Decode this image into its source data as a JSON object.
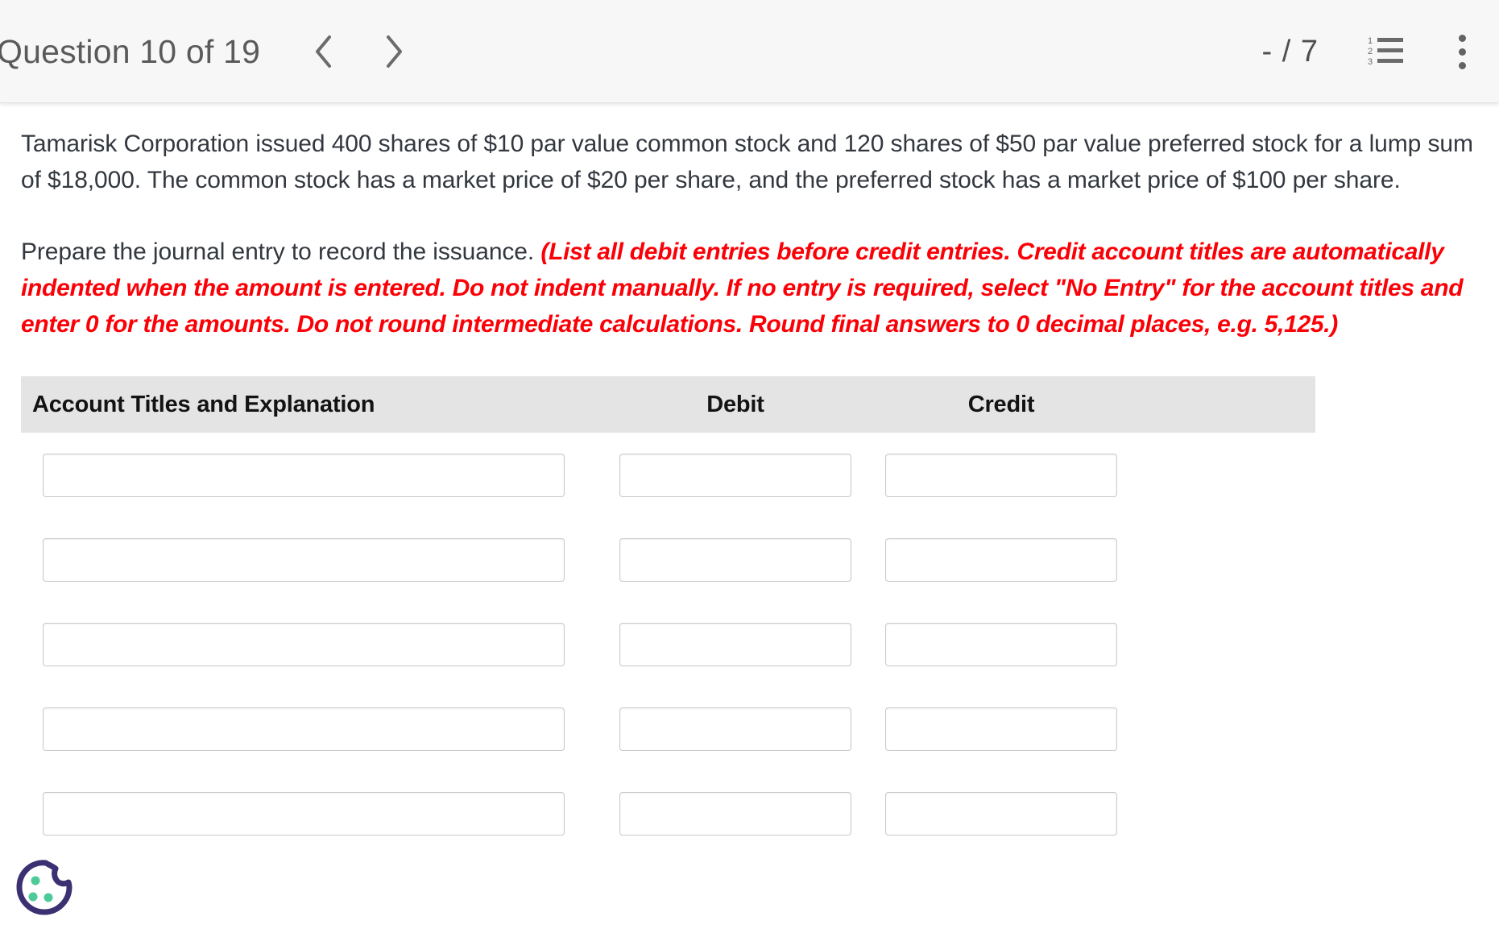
{
  "header": {
    "question_label": "Question 10 of 19",
    "prev_icon": "chevron-left-icon",
    "next_icon": "chevron-right-icon",
    "score": "- / 7",
    "list_icon": "numbered-list-icon",
    "menu_icon": "kebab-menu-icon"
  },
  "question": {
    "paragraph_1": "Tamarisk Corporation issued 400 shares of $10 par value common stock and 120 shares of $50 par value preferred stock for a lump sum of $18,000. The common stock has a market price of $20 per share, and the preferred stock has a market price of $100 per share.",
    "paragraph_2_lead": "Prepare the journal entry to record the issuance.",
    "paragraph_2_instructions": "(List all debit entries before credit entries. Credit account titles are automatically indented when the amount is entered. Do not indent manually. If no entry is required, select \"No Entry\" for the account titles and enter 0 for the amounts. Do not round intermediate calculations. Round final answers to 0 decimal places, e.g. 5,125.)"
  },
  "table": {
    "headers": {
      "account": "Account Titles and Explanation",
      "debit": "Debit",
      "credit": "Credit"
    },
    "rows": [
      {
        "account": "",
        "debit": "",
        "credit": ""
      },
      {
        "account": "",
        "debit": "",
        "credit": ""
      },
      {
        "account": "",
        "debit": "",
        "credit": ""
      },
      {
        "account": "",
        "debit": "",
        "credit": ""
      },
      {
        "account": "",
        "debit": "",
        "credit": ""
      }
    ]
  },
  "cookie": {
    "icon": "cookie-icon",
    "outline_color": "#3b3071",
    "dot_color": "#4dc99a"
  },
  "colors": {
    "instruction_red": "#fb0007",
    "body_text": "#33383f",
    "topbar_bg": "#f7f7f7",
    "table_header_bg": "#e4e4e4",
    "input_border": "#c9c9c9"
  }
}
